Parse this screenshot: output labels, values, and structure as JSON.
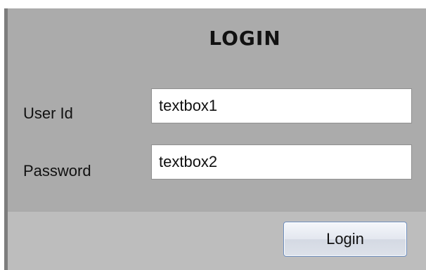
{
  "form": {
    "title": "LOGIN",
    "fields": [
      {
        "label": "User Id",
        "value": "textbox1"
      },
      {
        "label": "Password",
        "value": "textbox2"
      }
    ],
    "login_button_label": "Login"
  },
  "colors": {
    "form_background": "#ababab",
    "button_bar_background": "#bdbdbd",
    "button_border": "#6f8fbf"
  }
}
